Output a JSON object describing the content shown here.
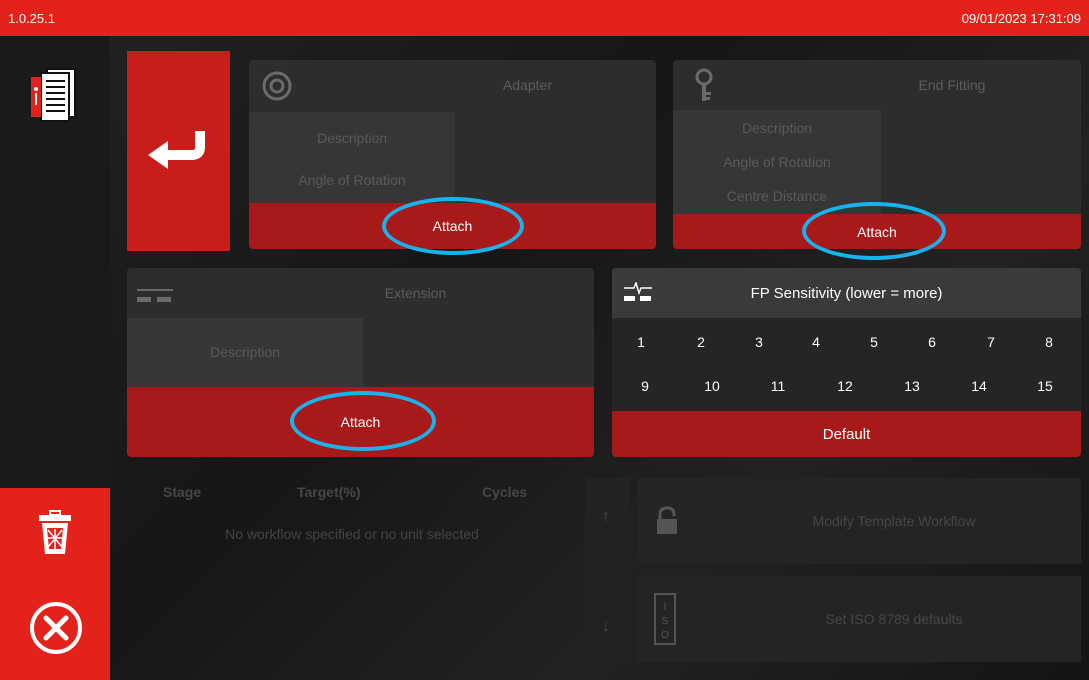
{
  "header": {
    "version": "1.0.25.1",
    "datetime": "09/01/2023 17:31:09"
  },
  "sidebar": {
    "manual_icon": "manual-icon",
    "delete_icon": "trash-icon",
    "close_icon": "close-icon"
  },
  "back_button": {
    "icon": "return-arrow-icon"
  },
  "adapter": {
    "title": "Adapter",
    "fields": [
      "Description",
      "Angle of Rotation"
    ],
    "attach_label": "Attach",
    "icon": "target-icon"
  },
  "end_fitting": {
    "title": "End Fitting",
    "fields": [
      "Description",
      "Angle of Rotation",
      "Centre Distance"
    ],
    "attach_label": "Attach",
    "icon": "key-icon"
  },
  "extension": {
    "title": "Extension",
    "fields": [
      "Description"
    ],
    "attach_label": "Attach",
    "icon": "extension-icon"
  },
  "fp_sensitivity": {
    "title": "FP Sensitivity (lower = more)",
    "row1": [
      "1",
      "2",
      "3",
      "4",
      "5",
      "6",
      "7",
      "8"
    ],
    "row2": [
      "9",
      "10",
      "11",
      "12",
      "13",
      "14",
      "15"
    ],
    "default_label": "Default"
  },
  "workflow": {
    "columns": [
      "Stage",
      "Target(%)",
      "Cycles"
    ],
    "empty_message": "No workflow specified or no unit selected"
  },
  "actions": {
    "modify_label": "Modify Template Workflow",
    "iso_label": "Set ISO 8789 defaults"
  },
  "colors": {
    "accent": "#e3221c",
    "attach": "#a81a1a",
    "highlight": "#1ab2ee"
  }
}
